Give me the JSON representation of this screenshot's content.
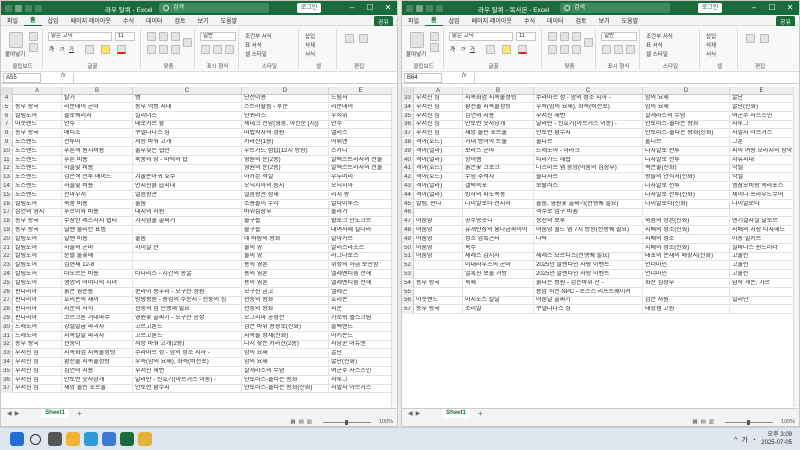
{
  "left": {
    "title": "라우 탈퀴 - Excel",
    "search_placeholder": "검색",
    "login": "로그인",
    "menu": [
      "파일",
      "홈",
      "삽입",
      "페이지 레이아웃",
      "수식",
      "데이터",
      "검토",
      "보기",
      "도움말"
    ],
    "share": "공유",
    "ribbon": {
      "clipboard": "클립보드",
      "paste": "붙여넣기",
      "font_group": "글꼴",
      "font_name": "맑은 고딕",
      "font_size": "11",
      "align_group": "맞춤",
      "number_group": "표시 형식",
      "number_format": "일반",
      "styles_group": "스타일",
      "cond_format": "조건부 서식",
      "table_format": "표 서식",
      "cell_style": "셀 스타일",
      "cells_group": "셀",
      "insert": "삽입",
      "delete": "삭제",
      "format": "서식",
      "edit_group": "편집"
    },
    "name_box": "A55",
    "fx": "fx",
    "columns": [
      "A",
      "B",
      "C",
      "D",
      "E"
    ],
    "rows": [
      {
        "n": "4",
        "c": [
          "",
          "탈거",
          "뱀",
          "단전이용",
          "드림처"
        ]
      },
      {
        "n": "5",
        "c": [
          "동부 왕국",
          "리분데어 군마",
          "동부 역병 지대",
          "스트라숄름 - 후문",
          "리분데어"
        ]
      },
      {
        "n": "6",
        "c": [
          "칼림도어",
          "블로쿼리지",
          "실리더스",
          "안퀴라즈",
          "우직위"
        ]
      },
      {
        "n": "7",
        "c": [
          "아웃랜드",
          "안주",
          "테로카르 숲",
          "세데크 전당(영웅, 아킨둔 [시])",
          "안주"
        ]
      },
      {
        "n": "8",
        "c": [
          "동부 왕국",
          "매티조",
          "쿠엘다나스 섬",
          "마법학자의 정원",
          "앨리스"
        ]
      },
      {
        "n": "9",
        "c": [
          "노스렌드",
          "전루마",
          "저승 바워 고개",
          "카라잔(1층)",
          "어휘앤"
        ]
      },
      {
        "n": "10",
        "c": [
          "노스렌드",
          "푸른색 원시비룡",
          "울부짖는 협만",
          "우트가드 첨탑(12시 방향)",
          "스카디"
        ]
      },
      {
        "n": "11",
        "c": [
          "노스렌드",
          "푸른 비룡",
          "북풍의 땅 - 마력의 탑",
          "영원의 눈(2층)",
          "알렉스트라자의 선물"
        ]
      },
      {
        "n": "12",
        "c": [
          "노스렌드",
          "하늘빛 비룡",
          "",
          "영원의 눈(2층)",
          "알렉스트라자의 선물"
        ]
      },
      {
        "n": "13",
        "c": [
          "노스렌드",
          "검은색 전투 매머드",
          "겨울손아귀 호수",
          "아카본 석실",
          "우두머리"
        ]
      },
      {
        "n": "14",
        "c": [
          "노스렌드",
          "하늘빛 비룡",
          "먼지진흙 습지대",
          "오닉시아의 둥지",
          "오닉시아"
        ]
      },
      {
        "n": "15",
        "c": [
          "노스렌드",
          "전마우저",
          "얼음왕관",
          "얼음왕관 성채",
          "리치 왕"
        ]
      },
      {
        "n": "16",
        "c": [
          "칼림도어",
          "북풍 비룡",
          "울둠",
          "소용돌이 누각",
          "알타이루스"
        ]
      },
      {
        "n": "17",
        "c": [
          "심연의 영지",
          "푸르미와 비룡",
          "대지의 사원",
          "바위심장부",
          "울라가"
        ]
      },
      {
        "n": "18",
        "c": [
          "동부 왕국",
          "무장한 레즈자시 랩터",
          "가시덤불 골짜기",
          "줄구룹",
          "할로크 만도크르"
        ]
      },
      {
        "n": "19",
        "c": [
          "동부 왕국",
          "날쌘 줄리칸 표범",
          "",
          "줄구룹",
          "대여사제 킬나라"
        ]
      },
      {
        "n": "20",
        "c": [
          "칼림도어",
          "날쌘 비룡",
          "울둠",
          "네 바람의 왕좌",
          "알아카르"
        ]
      },
      {
        "n": "21",
        "c": [
          "칼림도어",
          "하늘의 군마",
          "하이잘 산",
          "불의 땅",
          "알리스라조르"
        ]
      },
      {
        "n": "22",
        "c": [
          "칼림도어",
          "순혈 불꽃매",
          "",
          "불의 땅",
          "라그나로스"
        ]
      },
      {
        "n": "23",
        "c": [
          "칼림도어",
          "심현체 12-8",
          "",
          "용의 영혼",
          "위성의 하급 보관함"
        ]
      },
      {
        "n": "24",
        "c": [
          "칼림도어",
          "타오르는 비룡",
          "타나리스 - 시간의 동굴",
          "용의 영혼",
          "엘레멘티움 전해"
        ]
      },
      {
        "n": "25",
        "c": [
          "칼림도어",
          "생명의 어머니의 시녀",
          "",
          "용의 영혼",
          "엘레멘티움 전해"
        ]
      },
      {
        "n": "26",
        "c": [
          "판다리아",
          "붉은 영운룡",
          "쿤라이 봉우리 - 모구샨 정원",
          "모구샨 금고",
          "엘레곤"
        ]
      },
      {
        "n": "27",
        "c": [
          "판다리아",
          "호리온의 새끼",
          "탕랑평원 - 용염의 주둔지 - 천둥의 섬",
          "천둥의 왕좌",
          "호리온"
        ]
      },
      {
        "n": "28",
        "c": [
          "판다리아",
          "지운의 자식",
          "천둥의 섬 인행해 필요",
          "천둥의 왕좌",
          "지운"
        ]
      },
      {
        "n": "29",
        "c": [
          "판다리아",
          "코르크론 거대파수",
          "영원꽃 골짜기 - 오구샨 공성",
          "오그리마 공성전",
          "가로쉬 헬스크림"
        ]
      },
      {
        "n": "30",
        "c": [
          "드레노어",
          "강철발굽 파괴자",
          "고르고론드",
          "검은 바위 용광로(신화)",
          "블랙핸드"
        ]
      },
      {
        "n": "31",
        "c": [
          "드레노어",
          "지옥칼날 파괴자",
          "고르고론드",
          "지옥불 성채(신화)",
          "아키몬드"
        ]
      },
      {
        "n": "32",
        "c": [
          "동부 왕국",
          "천둥이",
          "저승 바워 고개(2층)",
          "다시 찾은 카라잔(2층)",
          "사냥꾼 어듀엔"
        ]
      },
      {
        "n": "33",
        "c": [
          "부서진 섬",
          "지옥화염 지옥불정령",
          "수라마르 성 - 밤의 성소 지하 -",
          "밤의 요새",
          "굴단"
        ]
      },
      {
        "n": "34",
        "c": [
          "부서진 섬",
          "황천불 지옥불정령",
          "우측(밤의 요새), 좌측(비전로)",
          "밤의 요새",
          "굴단(신화)"
        ]
      },
      {
        "n": "35",
        "c": [
          "부서진 섬",
          "심연의 지룡",
          "부서진 해변",
          "살게라스의 무덤",
          "여군주 사스즈인"
        ]
      },
      {
        "n": "36",
        "c": [
          "부서진 섬",
          "안토런 숫사냥개",
          "달라란 - 신호기(아르거스 이동) -",
          "안토러스-불타는 왕좌",
          "사투그"
        ]
      },
      {
        "n": "37",
        "c": [
          "부서진 섬",
          "재앙 불린 포르울",
          "안토런 황무지",
          "안토러스-불타는 왕좌(신화)",
          "사멸자 아르거스"
        ]
      }
    ],
    "sheet": "Sheet1",
    "zoom": "100%"
  },
  "right": {
    "title": "라우 탈퀴 - 복사본 - Excel",
    "search_placeholder": "검색",
    "login": "로그인",
    "menu": [
      "파일",
      "홈",
      "삽입",
      "페이지 레이아웃",
      "수식",
      "데이터",
      "검토",
      "보기",
      "도움말"
    ],
    "share": "공유",
    "ribbon": {
      "clipboard": "클립보드",
      "paste": "붙여넣기",
      "font_group": "글꼴",
      "font_name": "맑은 고딕",
      "font_size": "11",
      "align_group": "맞춤",
      "number_group": "표시 형식",
      "number_format": "일반",
      "styles_group": "스타일",
      "cond_format": "조건부 서식",
      "table_format": "표 서식",
      "cell_style": "셀 스타일",
      "cells_group": "셀",
      "insert": "삽입",
      "delete": "삭제",
      "format": "서식",
      "edit_group": "편집"
    },
    "name_box": "B64",
    "fx": "fx",
    "columns": [
      "A",
      "B",
      "C",
      "D",
      "E"
    ],
    "rows": [
      {
        "n": "33",
        "c": [
          "부서진 섬",
          "지옥화염 지옥불정령",
          "수라마르 성 - 밤의 성소 지하 -",
          "밤의 요새",
          "굴단"
        ]
      },
      {
        "n": "34",
        "c": [
          "부서진 섬",
          "황천불 지옥불정령",
          "우측(밤의 요새), 좌측(비전로)",
          "밤의 요새",
          "굴단(신화)"
        ]
      },
      {
        "n": "35",
        "c": [
          "부서진 섬",
          "심연의 지룡",
          "부서진 해변",
          "살게라스의 무덤",
          "여군주 사스즈인"
        ]
      },
      {
        "n": "36",
        "c": [
          "부서진 섬",
          "안토런 숫사냥개",
          "달라란 - 신호기(아르거스 이동) -",
          "안토러스-불타는 왕좌",
          "사투그"
        ]
      },
      {
        "n": "37",
        "c": [
          "부서진 섬",
          "재앙 불린 포르울",
          "안토런 황무지",
          "안토러스-불타는 왕좌(신화)",
          "사멸자 아르거스"
        ]
      },
      {
        "n": "38",
        "c": [
          "격아(호드)",
          "거대 방어막 트롤",
          "울다르",
          "울디르",
          "그훈"
        ]
      },
      {
        "n": "39",
        "c": [
          "격아(얼라)",
          "보라스 군마",
          "드레노어 - 아라크",
          "다자알로 전투",
          "피의 여왕 모라지의 장막"
        ]
      },
      {
        "n": "40",
        "c": [
          "격아(얼라)",
          "상어뱀",
          "티라가드 해협",
          "다자알로 전투",
          "자유지대"
        ]
      },
      {
        "n": "41",
        "c": [
          "격아(호드)",
          "붉은꽃 크로크",
          "나즈미르 맵 중앙(어둠의 심장부)",
          "썩은물(신화)",
          "악셀"
        ]
      },
      {
        "n": "42",
        "c": [
          "격아(호드)",
          "무덤 추적자",
          "줄다자르",
          "왕들의 안식처(신화)",
          "악셀"
        ]
      },
      {
        "n": "43",
        "c": [
          "격아(얼라)",
          "갤럭슥포",
          "보랄러스",
          "다자알로 전투",
          "엠잠오비왕 액라포스"
        ]
      },
      {
        "n": "44",
        "c": [
          "격아(얼라)",
          "빙하의 파도폭풍",
          "",
          "다자알로 전투(신화)",
          "제이나 프라우드무어"
        ]
      },
      {
        "n": "45",
        "c": [
          "칼림, 판다",
          "나이알로타 선지자",
          "울둠, 영원꽃 골짜기(선행퀘 필요)",
          "나이알로타(신화)",
          "나이알로타"
        ]
      },
      {
        "n": "46",
        "c": [
          "",
          "",
          "격주로 업구 바뀜",
          "",
          ""
        ]
      },
      {
        "n": "47",
        "c": [
          "어둠땅",
          "공수송곳니",
          "승천의 보루",
          "죽음의 상흔(신화)",
          "넨기걸사실 날토르"
        ]
      },
      {
        "n": "48",
        "c": [
          "어둠땅",
          "유개탄장의 흉나금파이어",
          "어둠땅 월드 맵 7시 방향(선행퀘 필요)",
          "지배의 성소(신화)",
          "지배의 시장 티자헤드"
        ]
      },
      {
        "n": "49",
        "c": [
          "어둠땅",
          "성소 암흑곤터",
          "나락",
          "지배의 성소",
          "아옹 빌키르"
        ]
      },
      {
        "n": "50",
        "c": [
          "어둠땅",
          "복수",
          "",
          "지배의 성소(신화)",
          "실바나스 윈드러너"
        ]
      },
      {
        "n": "51",
        "c": [
          "어둠땅",
          "제레스 감시자",
          "제레스 모르티스(선행퀘 필요)",
          "태초의 존재의 매장지(신화)",
          "고불린"
        ]
      },
      {
        "n": "52",
        "c": [
          "",
          "이내라우즈의 군마",
          "2025년 발렌타인 사랑 이벤트",
          "언더마인",
          "고불린"
        ]
      },
      {
        "n": "53",
        "c": [
          "",
          "열혹진 보물 가방",
          "2025년 발렌타인 사랑 이벤트",
          "언더마인",
          "고불린"
        ]
      },
      {
        "n": "54",
        "c": [
          "동부 왕국",
          "죽쇄",
          "붉다는 병원 - 검은바위 산 -",
          "화산 심장부",
          "남작 게돈, 가르"
        ]
      },
      {
        "n": "55",
        "c": [
          "",
          "",
          "용암 직전 NPC - 로스스 리프트웨이커",
          "",
          ""
        ]
      },
      {
        "n": "56",
        "c": [
          "아웃랜드",
          "아지노스 칼날",
          "어둠달 골짜기",
          "검은 사원",
          "일리단"
        ]
      },
      {
        "n": "57",
        "c": [
          "동부 왕국",
          "소리말",
          "쿠엘다나스 섬",
          "태양샘 고원",
          ""
        ]
      }
    ],
    "sheet": "Sheet1",
    "zoom": "100%"
  },
  "taskbar": {
    "time": "오후 3:09",
    "date": "2025-07-05",
    "lang": "가"
  },
  "colors": {
    "excel_green": "#1a6b3c"
  }
}
